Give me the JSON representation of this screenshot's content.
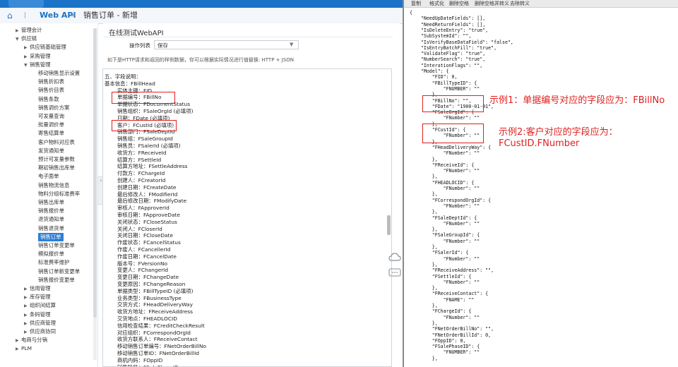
{
  "tabs": {
    "webapi": "Web API",
    "close": "×",
    "order": "销售订单 - 新增"
  },
  "sidebar": {
    "items": [
      {
        "label": "管理会计",
        "level": 1,
        "arrow": "▶"
      },
      {
        "label": "供应链",
        "level": 1,
        "arrow": "▼"
      },
      {
        "label": "供应链基础管理",
        "level": 2,
        "arrow": "▶"
      },
      {
        "label": "采购管理",
        "level": 2,
        "arrow": "▶"
      },
      {
        "label": "销售管理",
        "level": 2,
        "arrow": "▼"
      },
      {
        "label": "移动销售显示设置",
        "level": 3
      },
      {
        "label": "销售折扣表",
        "level": 3
      },
      {
        "label": "销售价目表",
        "level": 3
      },
      {
        "label": "销售条款",
        "level": 3
      },
      {
        "label": "销售调价方案",
        "level": 3
      },
      {
        "label": "可发量查询",
        "level": 3
      },
      {
        "label": "批量调价单",
        "level": 3
      },
      {
        "label": "寄售结算单",
        "level": 3
      },
      {
        "label": "客户物料对应表",
        "level": 3
      },
      {
        "label": "发货通知单",
        "level": 3
      },
      {
        "label": "预计可发量参数",
        "level": 3
      },
      {
        "label": "期初销售出库单",
        "level": 3
      },
      {
        "label": "电子面单",
        "level": 3
      },
      {
        "label": "销售物流信息",
        "level": 3
      },
      {
        "label": "物料分组标准费率",
        "level": 3
      },
      {
        "label": "销售出库单",
        "level": 3
      },
      {
        "label": "销售报价单",
        "level": 3
      },
      {
        "label": "退货通知单",
        "level": 3
      },
      {
        "label": "销售退货单",
        "level": 3
      },
      {
        "label": "销售订单",
        "level": 3,
        "selected": true
      },
      {
        "label": "销售订单变更单",
        "level": 3
      },
      {
        "label": "模拟报价单",
        "level": 3
      },
      {
        "label": "标准费率维护",
        "level": 3
      },
      {
        "label": "销售订单新变更单",
        "level": 3
      },
      {
        "label": "销售报价变更单",
        "level": 3
      },
      {
        "label": "信用管理",
        "level": 2,
        "arrow": "▶"
      },
      {
        "label": "库存管理",
        "level": 2,
        "arrow": "▶"
      },
      {
        "label": "组织间结算",
        "level": 2,
        "arrow": "▶"
      },
      {
        "label": "条码管理",
        "level": 2,
        "arrow": "▶"
      },
      {
        "label": "供应商管理",
        "level": 2,
        "arrow": "▶"
      },
      {
        "label": "供应商协同",
        "level": 2,
        "arrow": "▶"
      },
      {
        "label": "电商与分销",
        "level": 1,
        "arrow": "▶"
      },
      {
        "label": "PLM",
        "level": 1,
        "arrow": "▶"
      }
    ]
  },
  "main": {
    "subtitle": "在线测试WebAPI",
    "op_label": "操作列表",
    "op_value": "保存",
    "hint": "如下是HTTP请求和返回的样例数据，你可以根据实际情况进行值替换: HTTP + JSON",
    "fields": [
      "五、字段说明：",
      "基本信息：FBillHead",
      "    实体主键：FID",
      "    单据编号：FBillNo",
      "    单据状态：FDocumentStatus",
      "    销售组织：FSaleOrgId (必填项)",
      "    日期：FDate (必填项)",
      "    客户：FCustId (必填项)",
      "    销售部门：FSaleDeptId",
      "    销售组：FSaleGroupId",
      "    销售员：FSalerId (必填项)",
      "    收货方：FReceiveId",
      "    结算方：FSettleId",
      "    结算方地址：FSettleAddress",
      "    付款方：FChargeId",
      "    创建人：FCreatorId",
      "    创建日期：FCreateDate",
      "    最后修改人：FModifierId",
      "    最后修改日期：FModifyDate",
      "    审核人：FApproverId",
      "    审核日期：FApproveDate",
      "    关闭状态：FCloseStatus",
      "    关闭人：FCloserId",
      "    关闭日期：FCloseDate",
      "    作废状态：FCancelStatus",
      "    作废人：FCancellerId",
      "    作废日期：FCancelDate",
      "    版本号：FVersionNo",
      "    变更人：FChangerId",
      "    变更日期：FChangeDate",
      "    变更原因：FChangeReason",
      "    单据类型：FBillTypeID (必填项)",
      "    业务类型：FBusinessType",
      "    交货方式：FHeadDeliveryWay",
      "    收货方地址：FReceiveAddress",
      "    交货地点：FHEADLOCID",
      "    信用检查结果：FCreditCheckResult",
      "    对应组织：FCorrespondOrgId",
      "    收货方联系人：FReceiveContact",
      "    移动销售订单编号：FNetOrderBillNo",
      "    移动销售订单ID：FNetOrderBillId",
      "    商机内码：FOppID",
      "    销售阶段：FSalePhaseID"
    ]
  },
  "right": {
    "toolbar": [
      "复制",
      "格式化",
      "删除空格",
      "删除空格并转义",
      "去除转义"
    ],
    "json_lines": [
      "{",
      "    \"NeedUpDateFields\": [],",
      "    \"NeedReturnFields\": [],",
      "    \"IsDeleteEntry\": \"true\",",
      "    \"SubSystemId\": \"\",",
      "    \"IsVerifyBaseDataField\": \"false\",",
      "    \"IsEntryBatchFill\": \"true\",",
      "    \"ValidateFlag\": \"true\",",
      "    \"NumberSearch\": \"true\",",
      "    \"InterationFlags\": \"\",",
      "    \"Model\": {",
      "        \"FID\": 0,",
      "        \"FBillTypeID\": {",
      "            \"FNUMBER\": \"\"",
      "        },",
      "        \"FBillNo\": \"\",",
      "        \"FDate\": \"1900-01-01\",",
      "        \"FSaleOrgId\": {",
      "            \"FNumber\": \"\"",
      "        },",
      "        \"FCustId\": {",
      "            \"FNumber\": \"\"",
      "        },",
      "        \"FHeadDeliveryWay\": {",
      "            \"FNumber\": \"\"",
      "        },",
      "        \"FReceiveId\": {",
      "            \"FNumber\": \"\"",
      "        },",
      "        \"FHEADLOCID\": {",
      "            \"FNumber\": \"\"",
      "        },",
      "        \"FCorrespondOrgId\": {",
      "            \"FNumber\": \"\"",
      "        },",
      "        \"FSaleDeptId\": {",
      "            \"FNumber\": \"\"",
      "        },",
      "        \"FSaleGroupId\": {",
      "            \"FNumber\": \"\"",
      "        },",
      "        \"FSalerId\": {",
      "            \"FNumber\": \"\"",
      "        },",
      "        \"FReceiveAddress\": \"\",",
      "        \"FSettleId\": {",
      "            \"FNumber\": \"\"",
      "        },",
      "        \"FReceiveContact\": {",
      "            \"FNAME\": \"\"",
      "        },",
      "        \"FChargeId\": {",
      "            \"FNumber\": \"\"",
      "        },",
      "        \"FNetOrderBillNo\": \"\",",
      "        \"FNetOrderBillId\": 0,",
      "        \"FOppID\": 0,",
      "        \"FSalePhaseID\": {",
      "            \"FNUMBER\": \"\"",
      "        },"
    ],
    "annotation1": "示例1：单据编号对应的字段应为：FBillNo",
    "annotation2a": "示例2:客户对应的字段应为：",
    "annotation2b": "FCustID.FNumber"
  },
  "colors": {
    "accent": "#1a73c7",
    "selected": "#2d7fd3",
    "annotation": "#e02020"
  },
  "icons": [
    "cloud-icon",
    "chat-icon",
    "chevron-left-icon",
    "dropdown-caret-icon"
  ]
}
